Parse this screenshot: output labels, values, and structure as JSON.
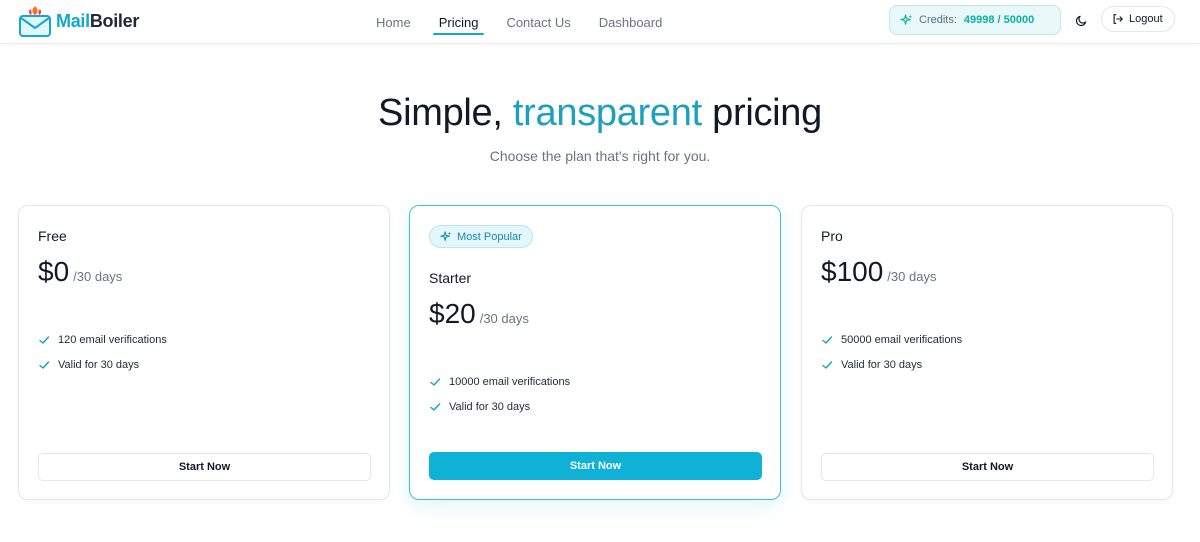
{
  "header": {
    "logo": {
      "part1": "Mail",
      "part2": "Boiler"
    },
    "nav": [
      {
        "label": "Home",
        "active": false
      },
      {
        "label": "Pricing",
        "active": true
      },
      {
        "label": "Contact Us",
        "active": false
      },
      {
        "label": "Dashboard",
        "active": false
      }
    ],
    "credits": {
      "label": "Credits:",
      "value": "49998 / 50000"
    },
    "logout_label": "Logout"
  },
  "hero": {
    "title_part1": "Simple,",
    "title_accent": "transparent",
    "title_part2": "pricing",
    "subtitle": "Choose the plan that's right for you."
  },
  "plans": [
    {
      "name": "Free",
      "price": "$0",
      "period": "/30 days",
      "features": [
        "120 email verifications",
        "Valid for 30 days"
      ],
      "cta": "Start Now"
    },
    {
      "badge": "Most Popular",
      "name": "Starter",
      "price": "$20",
      "period": "/30 days",
      "features": [
        "10000 email verifications",
        "Valid for 30 days"
      ],
      "cta": "Start Now"
    },
    {
      "name": "Pro",
      "price": "$100",
      "period": "/30 days",
      "features": [
        "50000 email verifications",
        "Valid for 30 days"
      ],
      "cta": "Start Now"
    }
  ],
  "colors": {
    "accent": "#12a9cc",
    "credits_value": "#10b0a0",
    "primary_button": "#0fb2d6"
  }
}
